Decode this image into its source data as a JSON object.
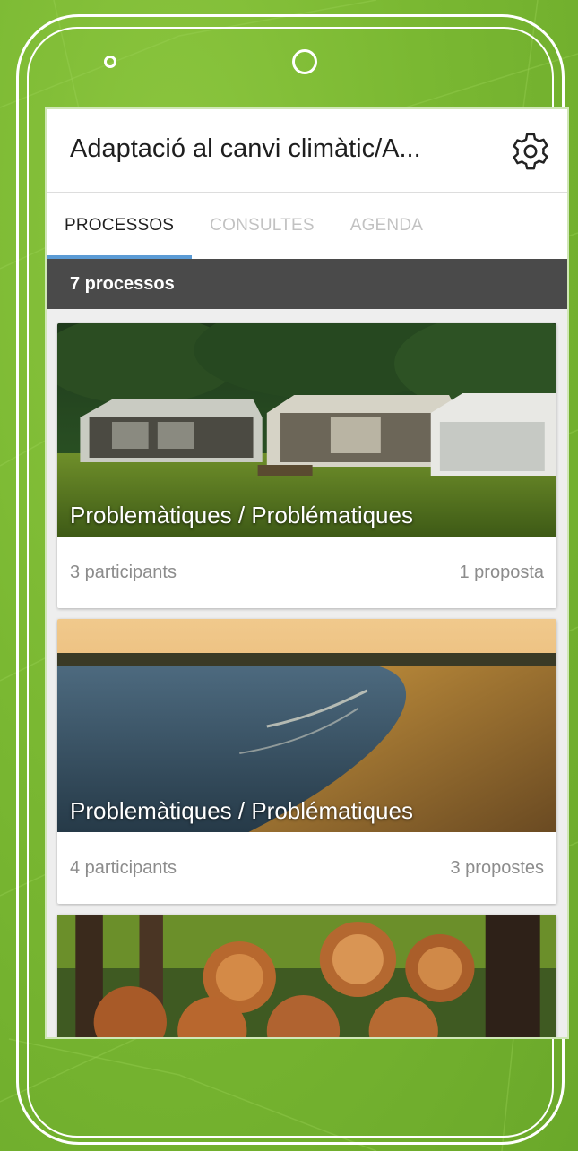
{
  "app": {
    "title": "Adaptació al canvi climàtic/A...",
    "settings_icon": "gear-icon"
  },
  "tabs": [
    {
      "label": "PROCESSOS",
      "active": true
    },
    {
      "label": "CONSULTES",
      "active": false
    },
    {
      "label": "AGENDA",
      "active": false
    }
  ],
  "count_label": "7 processos",
  "cards": [
    {
      "title": "Problemàtiques / Problématiques",
      "participants": "3 participants",
      "proposals": "1 proposta",
      "image": "campsite-tents"
    },
    {
      "title": "Problemàtiques / Problématiques",
      "participants": "4 participants",
      "proposals": "3 propostes",
      "image": "lake-shore-sunset"
    },
    {
      "title": "",
      "participants": "",
      "proposals": "",
      "image": "cut-logs-forest"
    }
  ],
  "colors": {
    "background": "#7ab832",
    "tab_indicator": "#5b9bd5",
    "count_bar": "#4a4a4a"
  }
}
